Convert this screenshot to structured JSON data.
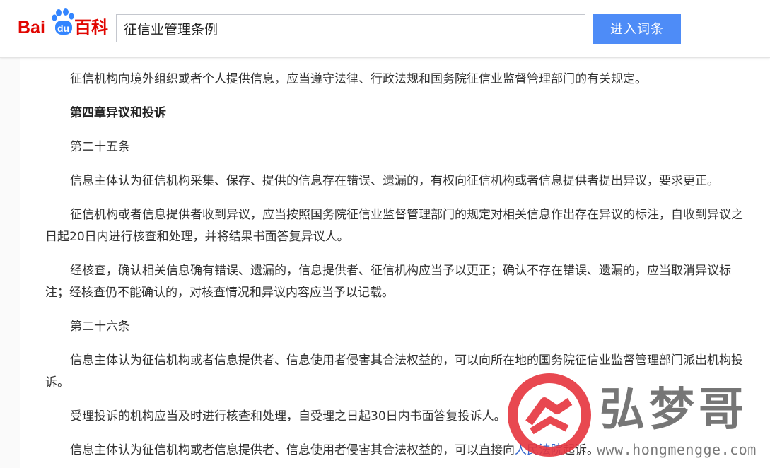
{
  "header": {
    "logo_text": "Bai百科",
    "logo_colors": {
      "red": "#e10601",
      "blue": "#3385ff"
    },
    "search_value": "征信业管理条例",
    "search_button_label": "进入词条"
  },
  "article": {
    "paragraphs": [
      {
        "kind": "text",
        "text": "征信机构向境外组织或者个人提供信息，应当遵守法律、行政法规和国务院征信业监督管理部门的有关规定。"
      },
      {
        "kind": "heading",
        "text": "第四章异议和投诉"
      },
      {
        "kind": "text",
        "text": "第二十五条"
      },
      {
        "kind": "text",
        "text": "信息主体认为征信机构采集、保存、提供的信息存在错误、遗漏的，有权向征信机构或者信息提供者提出异议，要求更正。"
      },
      {
        "kind": "text",
        "text": "征信机构或者信息提供者收到异议，应当按照国务院征信业监督管理部门的规定对相关信息作出存在异议的标注，自收到异议之日起20日内进行核查和处理，并将结果书面答复异议人。"
      },
      {
        "kind": "text",
        "text": "经核查，确认相关信息确有错误、遗漏的，信息提供者、征信机构应当予以更正；确认不存在错误、遗漏的，应当取消异议标注；经核查仍不能确认的，对核查情况和异议内容应当予以记载。"
      },
      {
        "kind": "text",
        "text": "第二十六条"
      },
      {
        "kind": "text",
        "text": "信息主体认为征信机构或者信息提供者、信息使用者侵害其合法权益的，可以向所在地的国务院征信业监督管理部门派出机构投诉。"
      },
      {
        "kind": "text",
        "text": "受理投诉的机构应当及时进行核查和处理，自受理之日起30日内书面答复投诉人。"
      }
    ],
    "last_paragraph": {
      "before": "信息主体认为征信机构或者信息提供者、信息使用者侵害其合法权益的，可以直接向",
      "link": "人民法院",
      "after": "起诉。"
    }
  },
  "watermark": {
    "text": "弘梦哥",
    "url": "www.hongmengge.com",
    "ring_color": "#e5343d"
  }
}
